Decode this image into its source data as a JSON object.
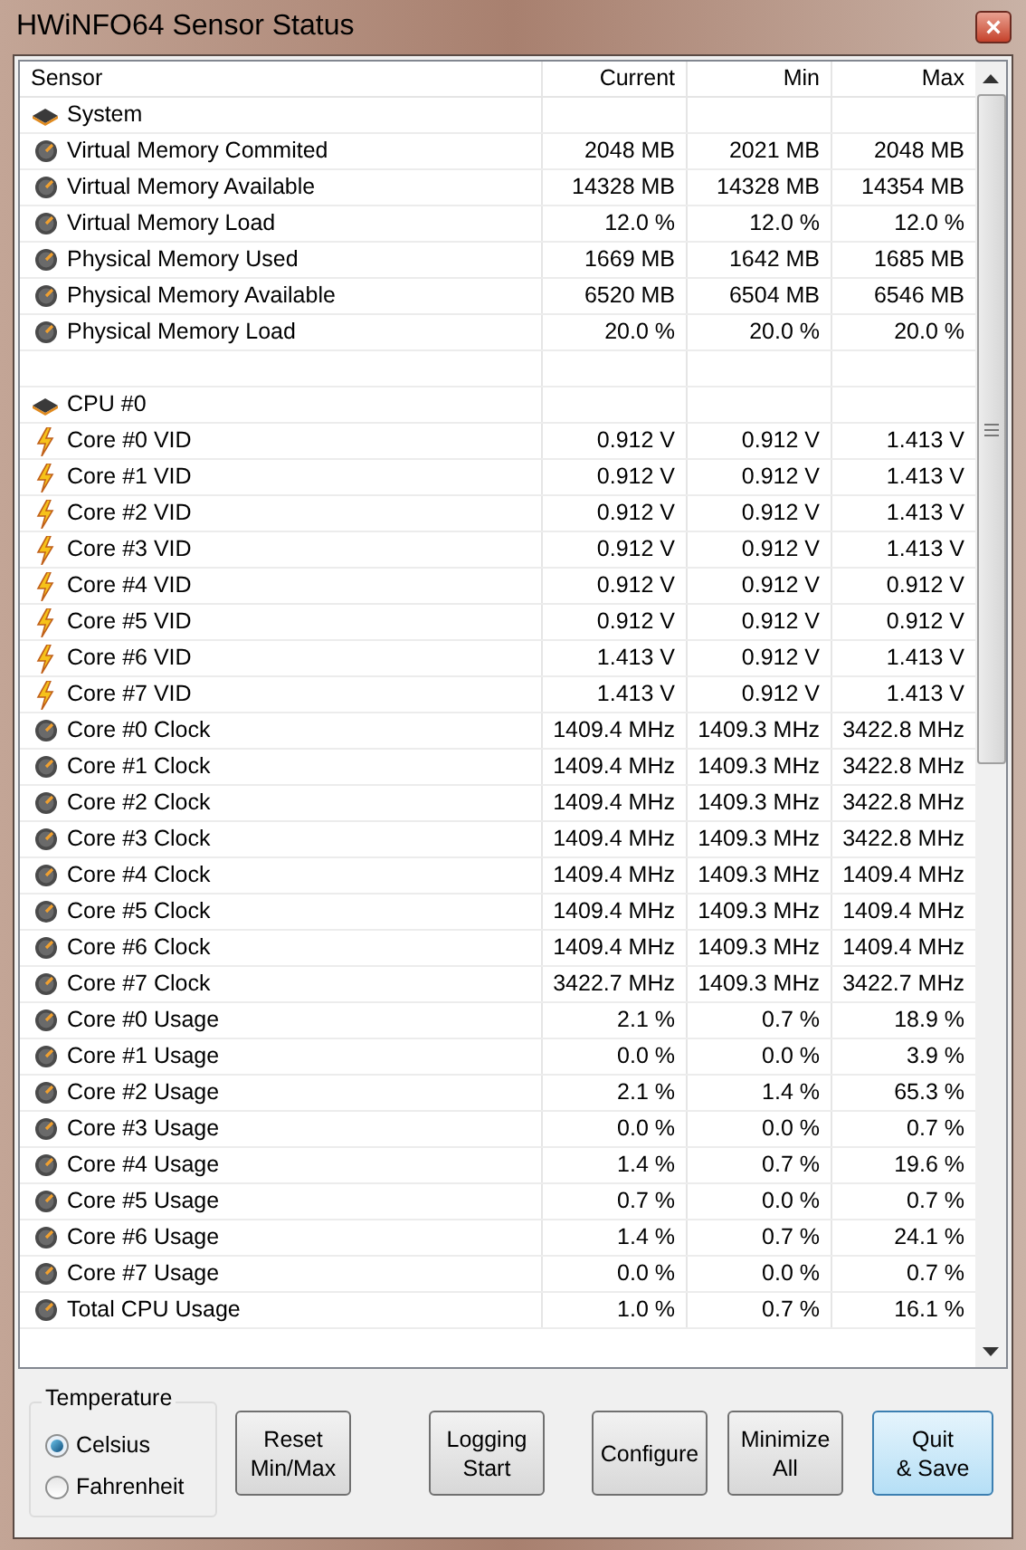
{
  "window": {
    "title": "HWiNFO64 Sensor Status",
    "close": "×"
  },
  "table": {
    "columns": [
      "Sensor",
      "Current",
      "Min",
      "Max"
    ],
    "rows": [
      {
        "kind": "group",
        "name": "System"
      },
      {
        "kind": "sensor",
        "name": "Virtual Memory Commited",
        "current": "2048 MB",
        "min": "2021 MB",
        "max": "2048 MB"
      },
      {
        "kind": "sensor",
        "name": "Virtual Memory Available",
        "current": "14328 MB",
        "min": "14328 MB",
        "max": "14354 MB"
      },
      {
        "kind": "sensor",
        "name": "Virtual Memory Load",
        "current": "12.0 %",
        "min": "12.0 %",
        "max": "12.0 %"
      },
      {
        "kind": "sensor",
        "name": "Physical Memory Used",
        "current": "1669 MB",
        "min": "1642 MB",
        "max": "1685 MB"
      },
      {
        "kind": "sensor",
        "name": "Physical Memory Available",
        "current": "6520 MB",
        "min": "6504 MB",
        "max": "6546 MB"
      },
      {
        "kind": "sensor",
        "name": "Physical Memory Load",
        "current": "20.0 %",
        "min": "20.0 %",
        "max": "20.0 %"
      },
      {
        "kind": "blank"
      },
      {
        "kind": "group",
        "name": "CPU #0"
      },
      {
        "kind": "voltage",
        "name": "Core #0 VID",
        "current": "0.912 V",
        "min": "0.912 V",
        "max": "1.413 V"
      },
      {
        "kind": "voltage",
        "name": "Core #1 VID",
        "current": "0.912 V",
        "min": "0.912 V",
        "max": "1.413 V"
      },
      {
        "kind": "voltage",
        "name": "Core #2 VID",
        "current": "0.912 V",
        "min": "0.912 V",
        "max": "1.413 V"
      },
      {
        "kind": "voltage",
        "name": "Core #3 VID",
        "current": "0.912 V",
        "min": "0.912 V",
        "max": "1.413 V"
      },
      {
        "kind": "voltage",
        "name": "Core #4 VID",
        "current": "0.912 V",
        "min": "0.912 V",
        "max": "0.912 V"
      },
      {
        "kind": "voltage",
        "name": "Core #5 VID",
        "current": "0.912 V",
        "min": "0.912 V",
        "max": "0.912 V"
      },
      {
        "kind": "voltage",
        "name": "Core #6 VID",
        "current": "1.413 V",
        "min": "0.912 V",
        "max": "1.413 V"
      },
      {
        "kind": "voltage",
        "name": "Core #7 VID",
        "current": "1.413 V",
        "min": "0.912 V",
        "max": "1.413 V"
      },
      {
        "kind": "sensor",
        "name": "Core #0 Clock",
        "current": "1409.4 MHz",
        "min": "1409.3 MHz",
        "max": "3422.8 MHz"
      },
      {
        "kind": "sensor",
        "name": "Core #1 Clock",
        "current": "1409.4 MHz",
        "min": "1409.3 MHz",
        "max": "3422.8 MHz"
      },
      {
        "kind": "sensor",
        "name": "Core #2 Clock",
        "current": "1409.4 MHz",
        "min": "1409.3 MHz",
        "max": "3422.8 MHz"
      },
      {
        "kind": "sensor",
        "name": "Core #3 Clock",
        "current": "1409.4 MHz",
        "min": "1409.3 MHz",
        "max": "3422.8 MHz"
      },
      {
        "kind": "sensor",
        "name": "Core #4 Clock",
        "current": "1409.4 MHz",
        "min": "1409.3 MHz",
        "max": "1409.4 MHz"
      },
      {
        "kind": "sensor",
        "name": "Core #5 Clock",
        "current": "1409.4 MHz",
        "min": "1409.3 MHz",
        "max": "1409.4 MHz"
      },
      {
        "kind": "sensor",
        "name": "Core #6 Clock",
        "current": "1409.4 MHz",
        "min": "1409.3 MHz",
        "max": "1409.4 MHz"
      },
      {
        "kind": "sensor",
        "name": "Core #7 Clock",
        "current": "3422.7 MHz",
        "min": "1409.3 MHz",
        "max": "3422.7 MHz"
      },
      {
        "kind": "sensor",
        "name": "Core #0 Usage",
        "current": "2.1 %",
        "min": "0.7 %",
        "max": "18.9 %"
      },
      {
        "kind": "sensor",
        "name": "Core #1 Usage",
        "current": "0.0 %",
        "min": "0.0 %",
        "max": "3.9 %"
      },
      {
        "kind": "sensor",
        "name": "Core #2 Usage",
        "current": "2.1 %",
        "min": "1.4 %",
        "max": "65.3 %"
      },
      {
        "kind": "sensor",
        "name": "Core #3 Usage",
        "current": "0.0 %",
        "min": "0.0 %",
        "max": "0.7 %"
      },
      {
        "kind": "sensor",
        "name": "Core #4 Usage",
        "current": "1.4 %",
        "min": "0.7 %",
        "max": "19.6 %"
      },
      {
        "kind": "sensor",
        "name": "Core #5 Usage",
        "current": "0.7 %",
        "min": "0.0 %",
        "max": "0.7 %"
      },
      {
        "kind": "sensor",
        "name": "Core #6 Usage",
        "current": "1.4 %",
        "min": "0.7 %",
        "max": "24.1 %"
      },
      {
        "kind": "sensor",
        "name": "Core #7 Usage",
        "current": "0.0 %",
        "min": "0.0 %",
        "max": "0.7 %"
      },
      {
        "kind": "sensor",
        "name": "Total CPU Usage",
        "current": "1.0 %",
        "min": "0.7 %",
        "max": "16.1 %"
      }
    ]
  },
  "temperature": {
    "title": "Temperature",
    "options": [
      {
        "label": "Celsius",
        "selected": true
      },
      {
        "label": "Fahrenheit",
        "selected": false
      }
    ]
  },
  "buttons": [
    {
      "lines": [
        "Reset",
        "Min/Max"
      ],
      "default": false
    },
    {
      "lines": [
        "Logging",
        "Start"
      ],
      "default": false
    },
    {
      "lines": [
        "Configure"
      ],
      "default": false
    },
    {
      "lines": [
        "Minimize",
        "All"
      ],
      "default": false
    },
    {
      "lines": [
        "Quit",
        "& Save"
      ],
      "default": true
    }
  ]
}
